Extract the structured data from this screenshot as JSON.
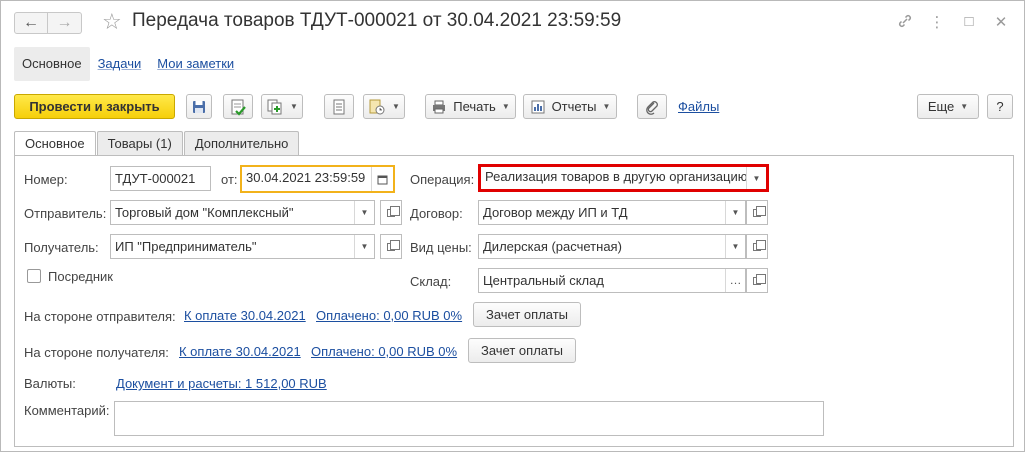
{
  "window": {
    "title": "Передача товаров ТДУТ-000021 от 30.04.2021 23:59:59"
  },
  "sections": {
    "main": "Основное",
    "tasks": "Задачи",
    "notes": "Мои заметки"
  },
  "toolbar": {
    "post_close": "Провести и закрыть",
    "print": "Печать",
    "reports": "Отчеты",
    "files": "Файлы",
    "more": "Еще",
    "help": "?"
  },
  "tabs": [
    "Основное",
    "Товары (1)",
    "Дополнительно"
  ],
  "form": {
    "number_label": "Номер:",
    "number_value": "ТДУТ-000021",
    "date_label": "от:",
    "date_value": "30.04.2021 23:59:59",
    "operation_label": "Операция:",
    "operation_value": "Реализация товаров в другую организацию",
    "sender_label": "Отправитель:",
    "sender_value": "Торговый дом \"Комплексный\"",
    "contract_label": "Договор:",
    "contract_value": "Договор между ИП и ТД",
    "receiver_label": "Получатель:",
    "receiver_value": "ИП \"Предприниматель\"",
    "price_type_label": "Вид цены:",
    "price_type_value": "Дилерская (расчетная)",
    "intermediary_label": "Посредник",
    "warehouse_label": "Склад:",
    "warehouse_value": "Центральный склад",
    "sender_side_label": "На стороне отправителя:",
    "sender_side_payment": "К оплате 30.04.2021",
    "sender_side_paid": "Оплачено: 0,00 RUB 0%",
    "sender_side_button": "Зачет оплаты",
    "receiver_side_label": "На стороне получателя:",
    "receiver_side_payment": "К оплате 30.04.2021",
    "receiver_side_paid": "Оплачено: 0,00 RUB 0%",
    "receiver_side_button": "Зачет оплаты",
    "currency_label": "Валюты:",
    "currency_link": "Документ и расчеты: 1 512,00 RUB",
    "comment_label": "Комментарий:",
    "comment_value": ""
  },
  "colors": {
    "primary_button": "#f6cf0a",
    "link": "#1c4fa0",
    "highlight_border": "#e00000",
    "focus_border": "#f2b21b"
  }
}
